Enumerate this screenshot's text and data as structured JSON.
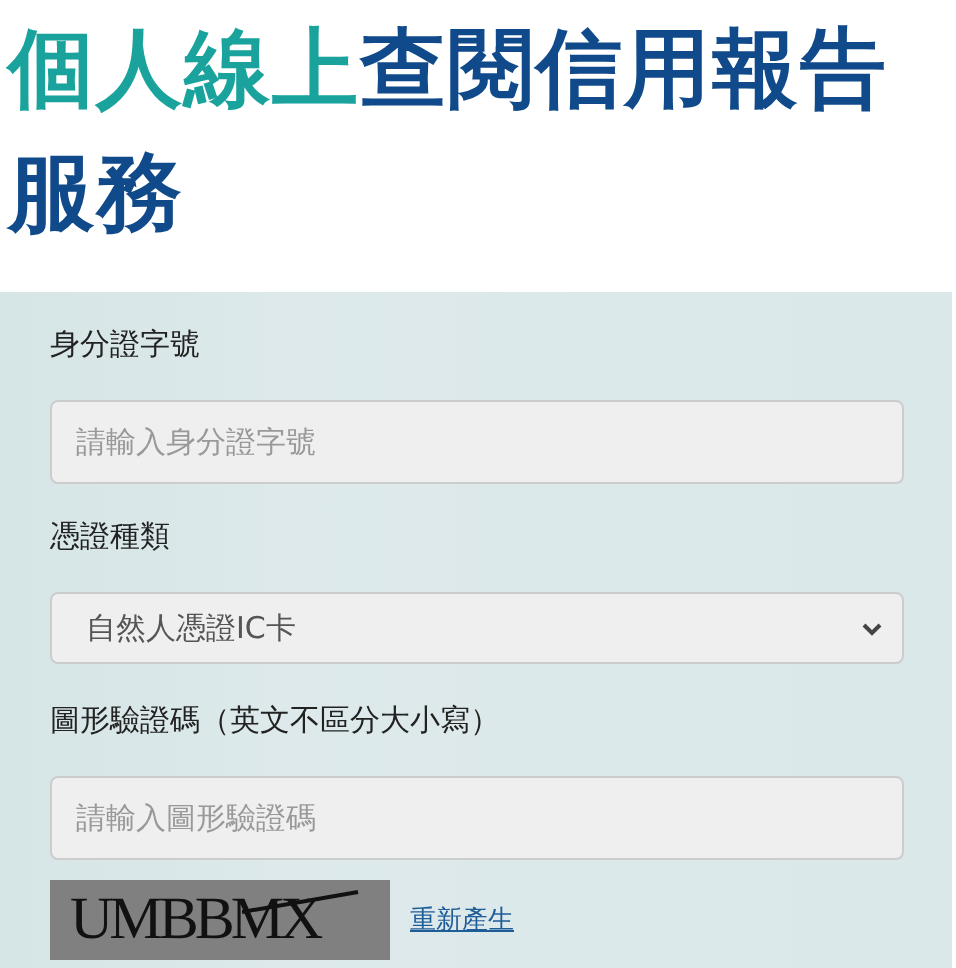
{
  "title": {
    "highlight": "個人線上",
    "rest": "查閱信用報告",
    "second_line": "服務"
  },
  "form": {
    "fields": [
      {
        "kind": "input",
        "label": "身分證字號",
        "placeholder": "請輸入身分證字號"
      },
      {
        "kind": "select",
        "label": "憑證種類",
        "value": "自然人憑證IC卡"
      },
      {
        "kind": "input",
        "label": "圖形驗證碼（英文不區分大小寫）",
        "placeholder": "請輸入圖形驗證碼"
      }
    ],
    "captcha": {
      "code": "UMBBMX",
      "refresh_link": "重新產生"
    }
  }
}
